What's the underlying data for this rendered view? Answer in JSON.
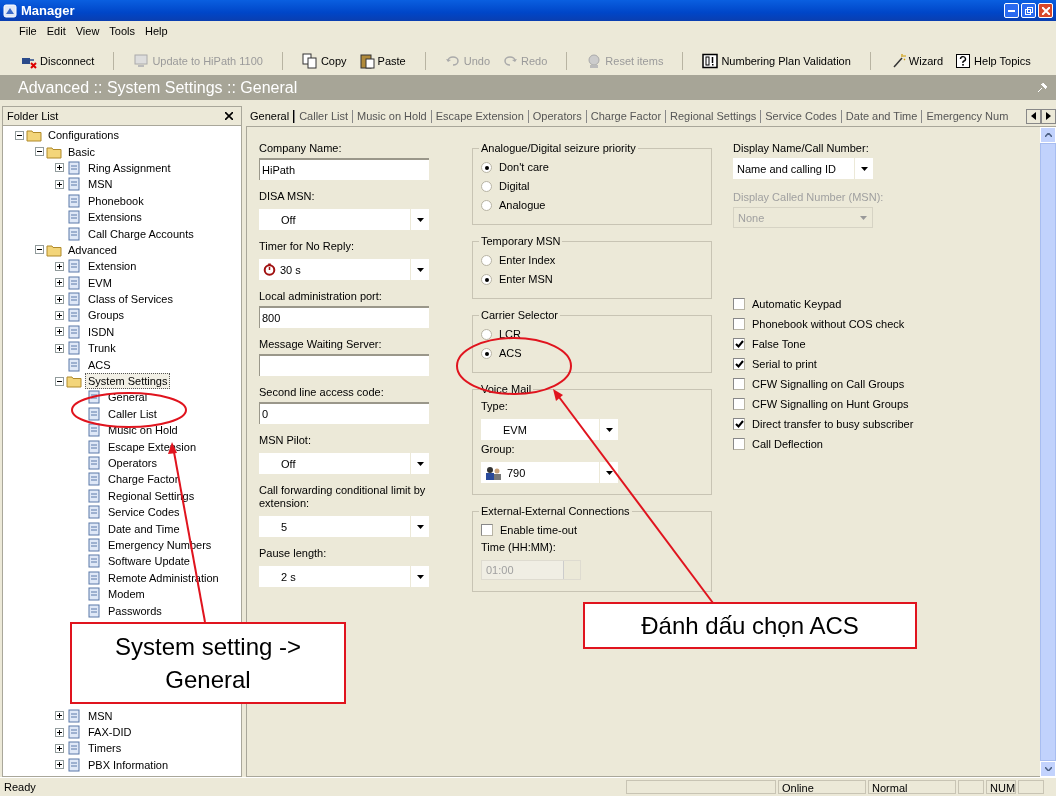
{
  "window": {
    "title": "Manager"
  },
  "menu": [
    "File",
    "Edit",
    "View",
    "Tools",
    "Help"
  ],
  "toolbar": [
    {
      "label": "Disconnect",
      "kind": "disconnect",
      "disabled": false
    },
    {
      "label": "Update to HiPath 1100",
      "kind": "update",
      "disabled": true
    },
    {
      "label": "Copy",
      "kind": "copy",
      "disabled": false
    },
    {
      "label": "Paste",
      "kind": "paste",
      "disabled": false
    },
    {
      "label": "Undo",
      "kind": "undo",
      "disabled": true
    },
    {
      "label": "Redo",
      "kind": "redo",
      "disabled": true
    },
    {
      "label": "Reset items",
      "kind": "reset",
      "disabled": true
    },
    {
      "label": "Numbering Plan Validation",
      "kind": "validate",
      "disabled": false
    },
    {
      "label": "Wizard",
      "kind": "wizard",
      "disabled": false
    },
    {
      "label": "Help Topics",
      "kind": "help",
      "disabled": false
    }
  ],
  "breadcrumb": "Advanced :: System Settings :: General",
  "folder_list": {
    "title": "Folder List",
    "tree": [
      {
        "label": "Configurations",
        "expanded": true,
        "selected": false,
        "children": [
          {
            "label": "Basic",
            "expanded": true,
            "selected": false,
            "children": [
              {
                "label": "Ring Assignment",
                "expanded": false,
                "selected": false
              },
              {
                "label": "MSN",
                "expanded": false,
                "selected": false
              },
              {
                "label": "Phonebook",
                "selected": false
              },
              {
                "label": "Extensions",
                "selected": false
              },
              {
                "label": "Call Charge Accounts",
                "selected": false
              }
            ]
          },
          {
            "label": "Advanced",
            "expanded": true,
            "selected": false,
            "children": [
              {
                "label": "Extension",
                "expanded": false,
                "selected": false
              },
              {
                "label": "EVM",
                "expanded": false,
                "selected": false
              },
              {
                "label": "Class of Services",
                "expanded": false,
                "selected": false
              },
              {
                "label": "Groups",
                "expanded": false,
                "selected": false
              },
              {
                "label": "ISDN",
                "expanded": false,
                "selected": false
              },
              {
                "label": "Trunk",
                "expanded": false,
                "selected": false
              },
              {
                "label": "ACS",
                "selected": false
              },
              {
                "label": "System Settings",
                "expanded": true,
                "selected": true,
                "children": [
                  {
                    "label": "General",
                    "selected": false
                  },
                  {
                    "label": "Caller List",
                    "selected": false
                  },
                  {
                    "label": "Music on Hold",
                    "selected": false
                  },
                  {
                    "label": "Escape Extension",
                    "selected": false
                  },
                  {
                    "label": "Operators",
                    "selected": false
                  },
                  {
                    "label": "Charge Factor",
                    "selected": false
                  },
                  {
                    "label": "Regional Settings",
                    "selected": false
                  },
                  {
                    "label": "Service Codes",
                    "selected": false
                  },
                  {
                    "label": "Date and Time",
                    "selected": false
                  },
                  {
                    "label": "Emergency Numbers",
                    "selected": false
                  },
                  {
                    "label": "Software Update",
                    "selected": false
                  },
                  {
                    "label": "Remote Administration",
                    "selected": false
                  },
                  {
                    "label": "Modem",
                    "selected": false
                  },
                  {
                    "label": "Passwords",
                    "selected": false
                  }
                ]
              }
            ]
          }
        ]
      }
    ],
    "lower_items": [
      {
        "label": "MSN",
        "expanded": false,
        "selected": false
      },
      {
        "label": "FAX-DID",
        "expanded": false,
        "selected": false
      },
      {
        "label": "Timers",
        "expanded": false,
        "selected": false
      },
      {
        "label": "PBX Information",
        "expanded": false,
        "selected": false
      }
    ]
  },
  "tabs": [
    {
      "label": "General",
      "selected": true
    },
    {
      "label": "Caller List",
      "selected": false
    },
    {
      "label": "Music on Hold",
      "selected": false
    },
    {
      "label": "Escape Extension",
      "selected": false
    },
    {
      "label": "Operators",
      "selected": false
    },
    {
      "label": "Charge Factor",
      "selected": false
    },
    {
      "label": "Regional Settings",
      "selected": false
    },
    {
      "label": "Service Codes",
      "selected": false
    },
    {
      "label": "Date and Time",
      "selected": false
    },
    {
      "label": "Emergency Num",
      "selected": false
    }
  ],
  "left_fields": [
    {
      "label": "Company Name:",
      "kind": "text",
      "value": "HiPath"
    },
    {
      "label": "DISA MSN:",
      "kind": "select",
      "value": "Off"
    },
    {
      "label": "Timer for No Reply:",
      "kind": "timer",
      "value": "30 s"
    },
    {
      "label": "Local administration port:",
      "kind": "text",
      "value": "800"
    },
    {
      "label": "Message Waiting Server:",
      "kind": "text"
    },
    {
      "label": "Second line access code:",
      "kind": "text",
      "value": "0"
    },
    {
      "label": "MSN Pilot:",
      "kind": "select",
      "value": "Off"
    },
    {
      "label": "Call forwarding conditional limit by extension:",
      "kind": "select",
      "value": "5"
    },
    {
      "label": "Pause length:",
      "kind": "select",
      "value": "2 s"
    }
  ],
  "groups": [
    {
      "title": "Analogue/Digital seizure priority",
      "kind": "radio",
      "options": [
        {
          "label": "Don't care",
          "selected": true
        },
        {
          "label": "Digital",
          "selected": false
        },
        {
          "label": "Analogue",
          "selected": false
        }
      ]
    },
    {
      "title": "Temporary MSN",
      "kind": "radio",
      "options": [
        {
          "label": "Enter Index",
          "selected": false
        },
        {
          "label": "Enter MSN",
          "selected": true
        }
      ]
    },
    {
      "title": "Carrier Selector",
      "kind": "radio",
      "options": [
        {
          "label": "LCR",
          "selected": false
        },
        {
          "label": "ACS",
          "selected": true
        }
      ]
    },
    {
      "title": "Voice Mail",
      "kind": "selects",
      "fields": [
        {
          "label": "Type:",
          "value": "EVM",
          "kind": "select"
        },
        {
          "label": "Group:",
          "value": "790",
          "kind": "group"
        }
      ]
    },
    {
      "title": "External-External Connections",
      "kind": "timeout",
      "checkbox": {
        "label": "Enable time-out",
        "checked": false
      },
      "time": {
        "label": "Time (HH:MM):",
        "value": "01:00",
        "disabled": true
      }
    }
  ],
  "display": [
    {
      "label": "Display Name/Call Number:",
      "value": "Name and calling ID",
      "disabled": false
    },
    {
      "label": "Display Called Number (MSN):",
      "value": "None",
      "disabled": true
    }
  ],
  "options": [
    {
      "label": "Automatic Keypad",
      "checked": false
    },
    {
      "label": "Phonebook without COS check",
      "checked": false
    },
    {
      "label": "False Tone",
      "checked": true
    },
    {
      "label": "Serial to print",
      "checked": true
    },
    {
      "label": "CFW Signalling on Call Groups",
      "checked": false
    },
    {
      "label": "CFW Signalling on Hunt Groups",
      "checked": false
    },
    {
      "label": "Direct transfer to busy subscriber",
      "checked": true
    },
    {
      "label": "Call Deflection",
      "checked": false
    }
  ],
  "status_bar": {
    "message": "Ready",
    "panels": [
      "Online",
      "Normal",
      "NUM"
    ]
  },
  "annotations": [
    {
      "text": "System setting -> General"
    },
    {
      "text": "Đánh dấu chọn ACS"
    }
  ]
}
